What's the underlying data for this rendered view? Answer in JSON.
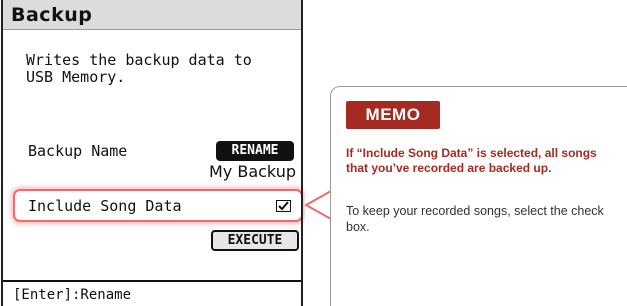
{
  "screen": {
    "title": "Backup",
    "description": "Writes the backup data to\nUSB Memory.",
    "backup_name_label": "Backup Name",
    "rename_button": "RENAME",
    "backup_name_value": "My Backup",
    "include_song_data_label": "Include Song Data",
    "include_song_data_checked": true,
    "execute_button": "EXECUTE",
    "footer_hint": "[Enter]:Rename"
  },
  "memo": {
    "badge": "MEMO",
    "emphasis": "If “Include Song Data” is selected, all songs that you’ve recorded are backed up.",
    "body": "To keep your recorded songs, select the check box."
  },
  "colors": {
    "highlight": "#ef6a6a",
    "memo_accent": "#a52a22",
    "title_bar": "#dcdcdc"
  }
}
